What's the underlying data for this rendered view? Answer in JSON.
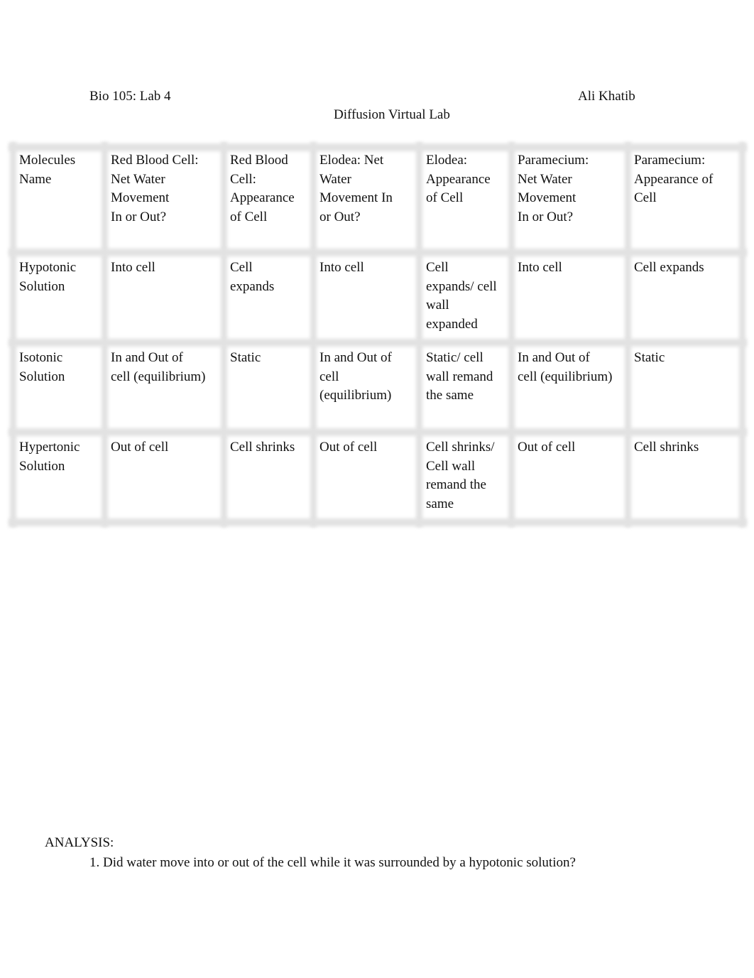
{
  "header": {
    "course": "Bio 105: Lab 4",
    "author": "Ali Khatib",
    "title": "Diffusion Virtual Lab"
  },
  "table": {
    "headers": [
      "Molecules\nName",
      "Red Blood Cell:\nNet Water\nMovement\nIn or Out?",
      "Red Blood\nCell:\nAppearance\nof Cell",
      "Elodea: Net\nWater\nMovement In\nor Out?",
      "Elodea:\nAppearance\nof Cell",
      "Paramecium:\nNet Water\nMovement\nIn or Out?",
      "Paramecium:\nAppearance of\nCell"
    ],
    "rows": [
      [
        "Hypotonic\nSolution",
        " Into cell",
        " Cell\nexpands",
        " Into cell",
        " Cell\nexpands/ cell\nwall\nexpanded",
        " Into cell",
        " Cell expands"
      ],
      [
        "Isotonic\nSolution",
        " In and Out of\ncell (equilibrium)",
        " Static",
        " In and Out of\ncell\n(equilibrium)",
        " Static/ cell\nwall remand\nthe same",
        " In and Out of\ncell (equilibrium)",
        " Static"
      ],
      [
        "Hypertonic\nSolution",
        "Out of cell",
        " Cell shrinks",
        " Out of cell",
        "Cell shrinks/\nCell wall\nremand the\nsame",
        " Out of cell",
        "Cell shrinks"
      ]
    ]
  },
  "analysis": {
    "label": "ANALYSIS:",
    "questions": [
      "1. Did water move into or out of the cell while it was surrounded by a hypotonic solution?"
    ]
  }
}
